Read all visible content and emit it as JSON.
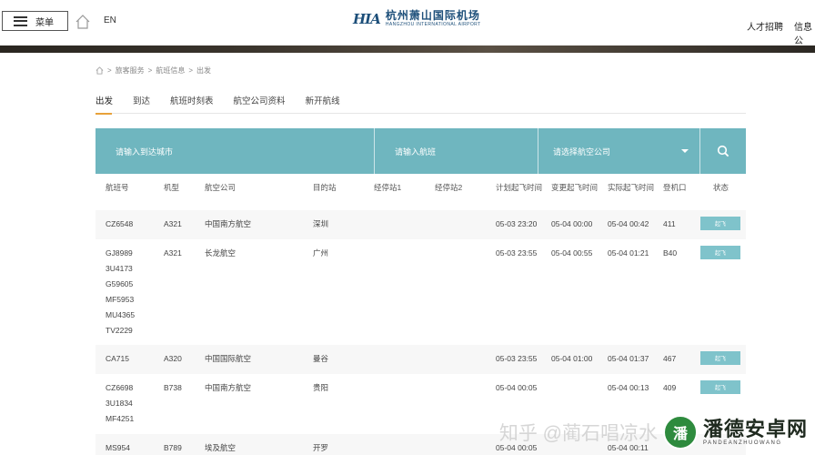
{
  "header": {
    "menu_label": "菜单",
    "lang": "EN",
    "logo_mark": "HIA",
    "logo_cn": "杭州萧山国际机场",
    "logo_en": "HANGZHOU INTERNATIONAL AIRPORT",
    "links": [
      "人才招聘",
      "信息公"
    ]
  },
  "breadcrumb": [
    "旅客服务",
    "航班信息",
    "出发"
  ],
  "tabs": [
    "出发",
    "到达",
    "航班时刻表",
    "航空公司资料",
    "新开航线"
  ],
  "search": {
    "city_placeholder": "请输入到达城市",
    "flight_placeholder": "请输入航班",
    "airline_placeholder": "请选择航空公司"
  },
  "table": {
    "headers": [
      "航班号",
      "机型",
      "航空公司",
      "目的站",
      "经停站1",
      "经停站2",
      "计划起飞时间",
      "变更起飞时间",
      "实际起飞时间",
      "登机口",
      "状态"
    ],
    "rows": [
      {
        "flight": "CZ6548",
        "aircraft": "A321",
        "airline": "中国南方航空",
        "dest": "深圳",
        "stop1": "",
        "stop2": "",
        "plan": "05-03 23:20",
        "changed": "05-04 00:00",
        "actual": "05-04 00:42",
        "gate": "411",
        "status": "起飞"
      },
      {
        "flight": "GJ8989",
        "flight_shares": [
          "3U4173",
          "G59605",
          "MF5953",
          "MU4365",
          "TV2229"
        ],
        "aircraft": "A321",
        "airline": "长龙航空",
        "dest": "广州",
        "stop1": "",
        "stop2": "",
        "plan": "05-03 23:55",
        "changed": "05-04 00:55",
        "actual": "05-04 01:21",
        "gate": "B40",
        "status": "起飞"
      },
      {
        "flight": "CA715",
        "aircraft": "A320",
        "airline": "中国国际航空",
        "dest": "曼谷",
        "stop1": "",
        "stop2": "",
        "plan": "05-03 23:55",
        "changed": "05-04 01:00",
        "actual": "05-04 01:37",
        "gate": "467",
        "status": "起飞"
      },
      {
        "flight": "CZ6698",
        "flight_shares": [
          "3U1834",
          "MF4251"
        ],
        "aircraft": "B738",
        "airline": "中国南方航空",
        "dest": "贵阳",
        "stop1": "",
        "stop2": "",
        "plan": "05-04 00:05",
        "changed": "",
        "actual": "05-04 00:13",
        "gate": "409",
        "status": "起飞"
      },
      {
        "flight": "MS954",
        "aircraft": "B789",
        "airline": "埃及航空",
        "dest": "开罗",
        "stop1": "",
        "stop2": "",
        "plan": "05-04 00:05",
        "changed": "",
        "actual": "05-04 00:11",
        "gate": "",
        "status": ""
      }
    ]
  },
  "watermark": {
    "zh": "知乎 @蔺石唱凉水",
    "badge": "潘",
    "brand": "潘德安卓网",
    "brand_en": "PANDEANZHUOWANG"
  },
  "colors": {
    "accent": "#6fb6bf",
    "status_btn": "#7fc3cb",
    "tab_underline": "#e8a23a",
    "logo_blue": "#1d4f7a"
  }
}
